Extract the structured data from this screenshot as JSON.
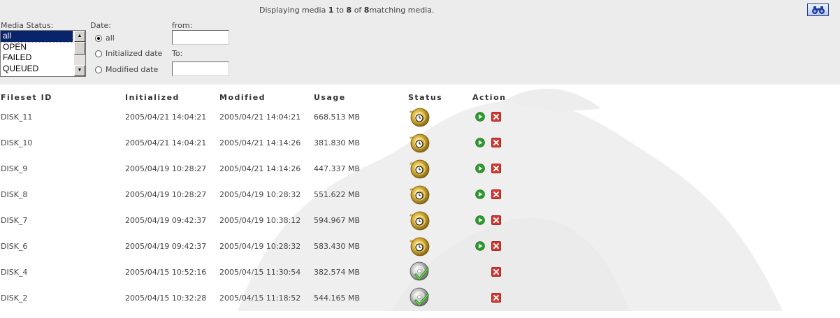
{
  "toolbar": {
    "status_prefix": "Displaying media",
    "range_start": "1",
    "to_word": "to",
    "range_end": "8",
    "of_word": "of",
    "total": "8",
    "status_suffix": "matching media.",
    "search_icon": "binoculars-icon"
  },
  "filters": {
    "media_status_label": "Media Status:",
    "media_status_options": [
      "all",
      "OPEN",
      "FAILED",
      "QUEUED"
    ],
    "media_status_selected": "all",
    "date_label": "Date:",
    "date_options": [
      "all",
      "Initialized date",
      "Modified date"
    ],
    "date_selected": "all",
    "from_label": "from:",
    "from_value": "",
    "to_label": "To:",
    "to_value": ""
  },
  "table": {
    "headers": [
      "Fileset ID",
      "Initialized",
      "Modified",
      "Usage",
      "Status",
      "Action"
    ],
    "rows": [
      {
        "id": "DISK_11",
        "initialized": "2005/04/21 14:04:21",
        "modified": "2005/04/21 14:04:21",
        "usage": "668.513 MB",
        "status": "open",
        "actions": [
          "start",
          "delete"
        ]
      },
      {
        "id": "DISK_10",
        "initialized": "2005/04/21 14:04:21",
        "modified": "2005/04/21 14:14:26",
        "usage": "381.830 MB",
        "status": "open",
        "actions": [
          "start",
          "delete"
        ]
      },
      {
        "id": "DISK_9",
        "initialized": "2005/04/19 10:28:27",
        "modified": "2005/04/21 14:14:26",
        "usage": "447.337 MB",
        "status": "open",
        "actions": [
          "start",
          "delete"
        ]
      },
      {
        "id": "DISK_8",
        "initialized": "2005/04/19 10:28:27",
        "modified": "2005/04/19 10:28:32",
        "usage": "551.622 MB",
        "status": "open",
        "actions": [
          "start",
          "delete"
        ]
      },
      {
        "id": "DISK_7",
        "initialized": "2005/04/19 09:42:37",
        "modified": "2005/04/19 10:38:12",
        "usage": "594.967 MB",
        "status": "open",
        "actions": [
          "start",
          "delete"
        ]
      },
      {
        "id": "DISK_6",
        "initialized": "2005/04/19 09:42:37",
        "modified": "2005/04/19 10:28:32",
        "usage": "583.430 MB",
        "status": "open",
        "actions": [
          "start",
          "delete"
        ]
      },
      {
        "id": "DISK_4",
        "initialized": "2005/04/15 10:52:16",
        "modified": "2005/04/15 11:30:54",
        "usage": "382.574 MB",
        "status": "completed",
        "actions": [
          "delete"
        ]
      },
      {
        "id": "DISK_2",
        "initialized": "2005/04/15 10:32:28",
        "modified": "2005/04/15 11:18:52",
        "usage": "544.165 MB",
        "status": "completed",
        "actions": [
          "delete"
        ]
      }
    ]
  },
  "icons": {
    "status_open": "folder-disc-clock-icon",
    "status_completed": "disc-checkmark-icon",
    "start": "play-icon",
    "delete": "delete-icon"
  },
  "colors": {
    "panel_bg": "#ececec",
    "selected_bg": "#0a246a",
    "play_green": "#2e9a2e",
    "delete_red": "#d9342b",
    "disc_gold": "#c9a227"
  }
}
